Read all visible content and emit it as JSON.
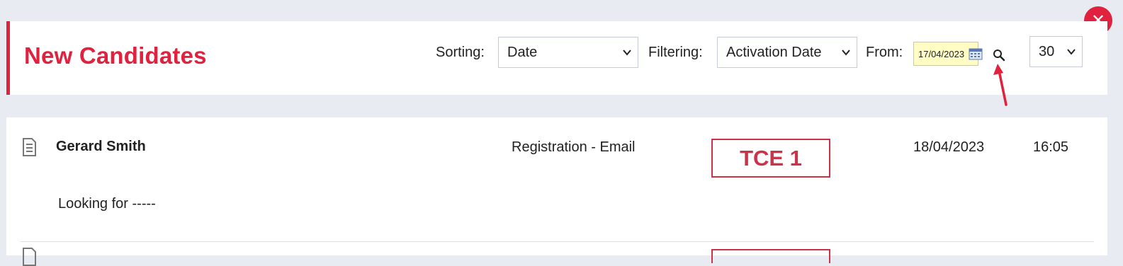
{
  "header": {
    "title": "New Candidates",
    "sorting_label": "Sorting:",
    "sorting_value": "Date",
    "filtering_label": "Filtering:",
    "filtering_value": "Activation Date",
    "from_label": "From:",
    "from_value": "17/04/2023",
    "page_size": "30"
  },
  "candidates": [
    {
      "name": "Gerard Smith",
      "source": "Registration - Email",
      "tag": "TCE 1",
      "date": "18/04/2023",
      "time": "16:05",
      "note": "Looking for -----"
    }
  ],
  "colors": {
    "accent": "#e0223f",
    "date_field_bg": "#fffcc4"
  },
  "icons": [
    "close-icon",
    "calendar-icon",
    "search-icon",
    "document-icon",
    "chevron-down-icon"
  ]
}
